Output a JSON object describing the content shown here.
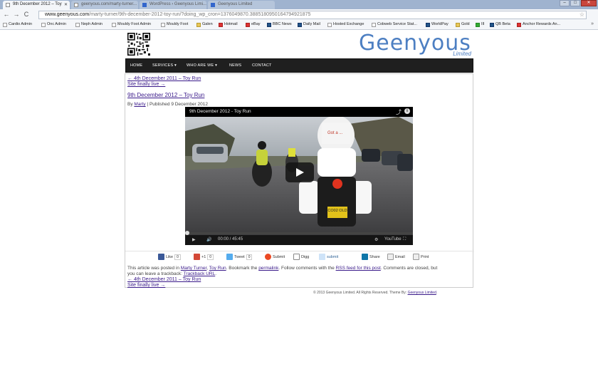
{
  "browser": {
    "tabs": [
      {
        "title": "9th December 2012 – Toy",
        "active": true
      },
      {
        "title": "geenyous.com/marty-turner...",
        "active": false
      },
      {
        "title": "WordPress › Geenyous Limi...",
        "active": false
      },
      {
        "title": "Geenyous Limited",
        "active": false
      }
    ],
    "window_buttons": {
      "minimize": "–",
      "maximize": "□",
      "close": "✕"
    },
    "nav": {
      "back": "←",
      "forward": "→",
      "reload": "C"
    },
    "url_host": "www.geenyous.com",
    "url_path": "/marty-turner/9th-december-2012-toy-run/?doing_wp_cron=1376049870.3885180950164794921875",
    "star": "☆",
    "menu": "≡",
    "bookmarks_more": "»",
    "bookmarks": [
      {
        "label": "Cardio Admin",
        "icon": "page"
      },
      {
        "label": "Onc Admin",
        "icon": "page"
      },
      {
        "label": "Neph Admin",
        "icon": "page"
      },
      {
        "label": "Mouldy Foot Admin",
        "icon": "page"
      },
      {
        "label": "Mouldy Foot",
        "icon": "page"
      },
      {
        "label": "Galen",
        "icon": "folder"
      },
      {
        "label": "Hotmail",
        "icon": "windows"
      },
      {
        "label": "eBay",
        "icon": "ebay"
      },
      {
        "label": "BBC News",
        "icon": "bbc"
      },
      {
        "label": "Daily Mail",
        "icon": "dm"
      },
      {
        "label": "Hosted Exchange",
        "icon": "page"
      },
      {
        "label": "Cobweb Service Stat...",
        "icon": "page"
      },
      {
        "label": "WorldPay",
        "icon": "worldpay"
      },
      {
        "label": "Gold",
        "icon": "folder"
      },
      {
        "label": "III",
        "icon": "blue"
      },
      {
        "label": "QB Beta",
        "icon": "blue"
      },
      {
        "label": "Anchor Rewards An...",
        "icon": "anchor"
      }
    ]
  },
  "site": {
    "logo_text": "Geenyous",
    "logo_sub": "Limited",
    "nav": [
      {
        "label": "HOME"
      },
      {
        "label": "SERVICES ▾"
      },
      {
        "label": "WHO ARE WE ▾"
      },
      {
        "label": "NEWS"
      },
      {
        "label": "CONTACT"
      }
    ],
    "top_prev": "← 4th December 2011 – Toy Run",
    "top_next": "Site finally live →",
    "post_title": "9th December 2012 – Toy Run",
    "by": "By",
    "author": "Marty",
    "published": "| Published 9 December 2012",
    "video": {
      "title": "9th December 2012 - Toy Run",
      "share_icon": "share-icon",
      "info": "i",
      "time": "00:00",
      "duration": "45:45",
      "controls_icons": [
        "play-icon",
        "volume-icon",
        "settings-icon",
        "youtube-logo",
        "fullscreen-icon"
      ],
      "youtube_label": "YouTube",
      "plate": "CO02 OLD"
    },
    "share": {
      "facebook": {
        "label": "Like",
        "count": "0"
      },
      "googleplus": {
        "label": "+1",
        "count": "0"
      },
      "twitter": {
        "label": "Tweet",
        "count": "0"
      },
      "stumble": {
        "label": "Submit"
      },
      "digg": {
        "label": "Digg"
      },
      "reddit": {
        "label": "submit"
      },
      "linkedin": {
        "label": "Share"
      },
      "email": {
        "label": "Email"
      },
      "print": {
        "label": "Print"
      }
    },
    "filed": {
      "t1": "This article was posted in",
      "cat1": "Marty Turner",
      "sep": ",",
      "cat2": "Toy Run",
      "t2": ". Bookmark the",
      "permalink": "permalink",
      "t3": ". Follow comments with the",
      "rss": "RSS feed for this post",
      "t4": ". Comments are closed, but you can leave a trackback:",
      "trackback": "Trackback URL",
      "t5": "."
    },
    "bottom_prev": "← 4th December 2011 – Toy Run",
    "bottom_next": "Site finally live →",
    "footer_text": "© 2013 Geenyous Limited. All Rights Reserved. Theme By:",
    "footer_link": "Geenyous Limited",
    "footer_end": "."
  }
}
